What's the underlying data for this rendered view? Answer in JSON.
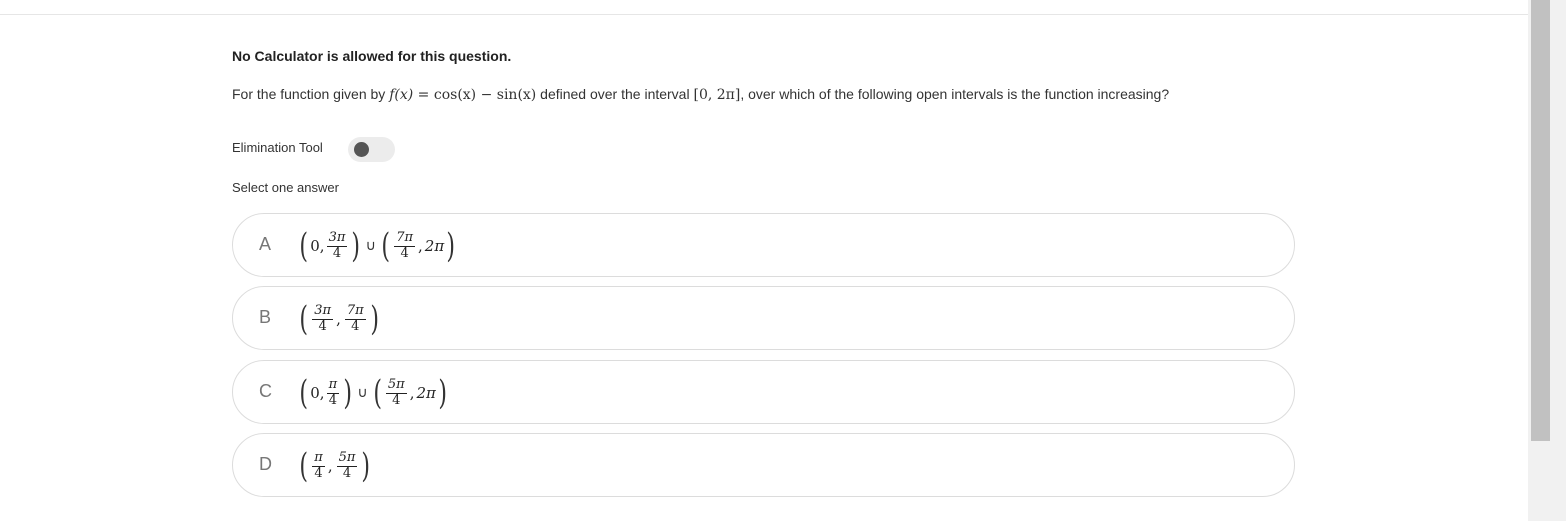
{
  "notice": "No Calculator is allowed for this question.",
  "question": {
    "prefix": "For the function given by",
    "f": "f(x)",
    "equals": " = ",
    "expr": "cos(x) − sin(x)",
    "middle": "defined over the interval",
    "interval": "[0, 2π]",
    "suffix": ", over which of the following open intervals is the function increasing?"
  },
  "elimination_tool": {
    "label": "Elimination Tool",
    "enabled": false
  },
  "select_prompt": "Select one answer",
  "options": [
    {
      "letter": "A",
      "left": {
        "a": "0,",
        "num": "3π",
        "den": "4"
      },
      "union": "∪",
      "right": {
        "num": "7π",
        "den": "4",
        "b": "2π"
      }
    },
    {
      "letter": "B",
      "num1": "3π",
      "den1": "4",
      "comma": ",",
      "num2": "7π",
      "den2": "4"
    },
    {
      "letter": "C",
      "left": {
        "a": "0,",
        "num": "π",
        "den": "4"
      },
      "union": "∪",
      "right": {
        "num": "5π",
        "den": "4",
        "b": "2π"
      }
    },
    {
      "letter": "D",
      "num1": "π",
      "den1": "4",
      "comma": ",",
      "num2": "5π",
      "den2": "4"
    }
  ]
}
